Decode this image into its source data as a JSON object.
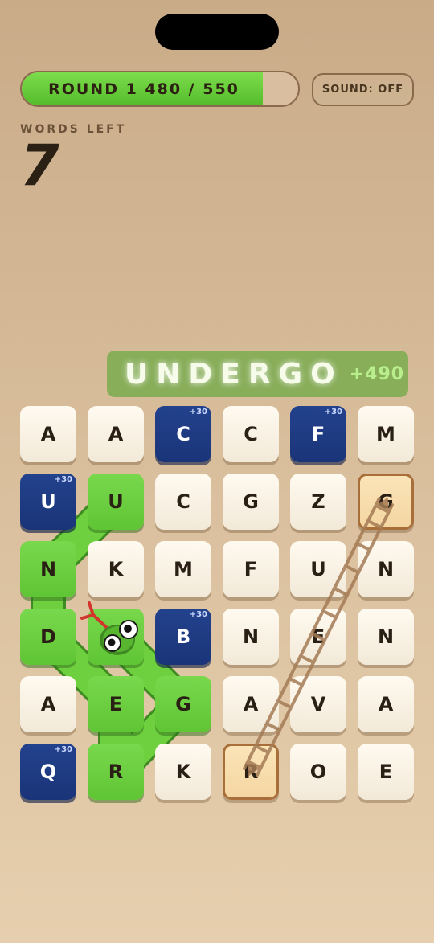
{
  "progress": {
    "text": "ROUND 1 480 / 550",
    "current": 480,
    "target": 550,
    "fraction": 0.873
  },
  "sound_button": "SOUND: OFF",
  "words_left": {
    "label": "WORDS LEFT",
    "value": "7"
  },
  "current_word": {
    "text": "UNDERGO",
    "score": "+490"
  },
  "colors": {
    "green": "#66c93a",
    "blue": "#1f3b85",
    "cream": "#f6eee0",
    "highlight": "#f6dcaa",
    "ladder": "#a47b55"
  },
  "grid": [
    [
      {
        "letter": "A",
        "style": "normal"
      },
      {
        "letter": "A",
        "style": "normal"
      },
      {
        "letter": "C",
        "style": "blue",
        "bonus": "+30"
      },
      {
        "letter": "C",
        "style": "normal"
      },
      {
        "letter": "F",
        "style": "blue",
        "bonus": "+30"
      },
      {
        "letter": "M",
        "style": "normal"
      }
    ],
    [
      {
        "letter": "U",
        "style": "blue",
        "bonus": "+30"
      },
      {
        "letter": "U",
        "style": "green"
      },
      {
        "letter": "C",
        "style": "normal"
      },
      {
        "letter": "G",
        "style": "normal"
      },
      {
        "letter": "Z",
        "style": "normal"
      },
      {
        "letter": "G",
        "style": "highlight"
      }
    ],
    [
      {
        "letter": "N",
        "style": "green"
      },
      {
        "letter": "K",
        "style": "normal"
      },
      {
        "letter": "M",
        "style": "normal"
      },
      {
        "letter": "F",
        "style": "normal"
      },
      {
        "letter": "U",
        "style": "normal"
      },
      {
        "letter": "N",
        "style": "normal"
      }
    ],
    [
      {
        "letter": "D",
        "style": "green"
      },
      {
        "letter": "",
        "style": "green"
      },
      {
        "letter": "B",
        "style": "blue",
        "bonus": "+30"
      },
      {
        "letter": "N",
        "style": "normal"
      },
      {
        "letter": "E",
        "style": "normal"
      },
      {
        "letter": "N",
        "style": "normal"
      }
    ],
    [
      {
        "letter": "A",
        "style": "normal"
      },
      {
        "letter": "E",
        "style": "green"
      },
      {
        "letter": "G",
        "style": "green"
      },
      {
        "letter": "A",
        "style": "normal"
      },
      {
        "letter": "V",
        "style": "normal"
      },
      {
        "letter": "A",
        "style": "normal"
      }
    ],
    [
      {
        "letter": "Q",
        "style": "blue",
        "bonus": "+30"
      },
      {
        "letter": "R",
        "style": "green"
      },
      {
        "letter": "K",
        "style": "normal"
      },
      {
        "letter": "R",
        "style": "highlight"
      },
      {
        "letter": "O",
        "style": "normal"
      },
      {
        "letter": "E",
        "style": "normal"
      }
    ]
  ],
  "snake_icon": "snake-head-icon",
  "ladder_icon": "ladder-icon"
}
